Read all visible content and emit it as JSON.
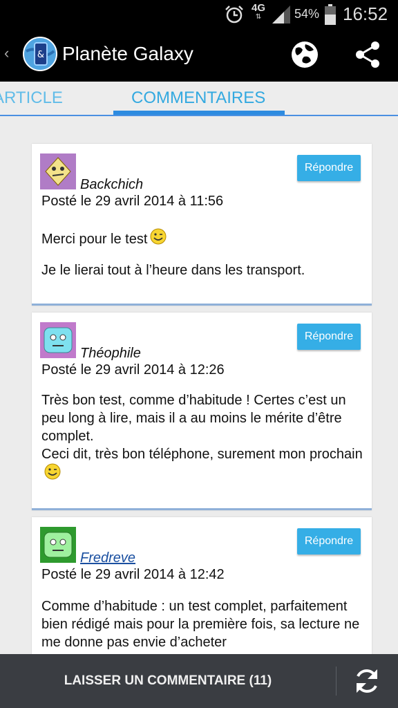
{
  "status_bar": {
    "network": "4G",
    "battery": "54%",
    "time": "16:52",
    "icons": [
      "alarm-icon",
      "signal-icon",
      "battery-icon"
    ]
  },
  "action_bar": {
    "title": "Planète Galaxy",
    "icons": [
      "back-chevron-icon",
      "app-logo",
      "globe-icon",
      "share-icon"
    ]
  },
  "tabs": [
    {
      "label": "ARTICLE",
      "selected": false
    },
    {
      "label": "COMMENTAIRES",
      "selected": true
    }
  ],
  "comments": [
    {
      "author": "Backchich",
      "date": "Posté le 29 avril 2014 à 11:56",
      "reply_label": "Répondre",
      "paragraphs": [
        "Merci pour le test",
        "Je le lierai tout à l’heure dans les transport."
      ]
    },
    {
      "author": "Théophile",
      "date": "Posté le 29 avril 2014 à 12:26",
      "reply_label": "Répondre",
      "paragraphs": [
        "Très bon test, comme d’habitude ! Certes c’est un peu long à lire, mais il a au moins le mérite d’être complet.",
        "Ceci dit, très bon téléphone, surement mon prochain"
      ]
    },
    {
      "author": "Fredreve",
      "date": "Posté le 29 avril 2014 à 12:42",
      "reply_label": "Répondre",
      "paragraphs": [
        "Comme d’habitude : un test complet, parfaitement bien rédigé mais pour la première fois, sa lecture ne me donne pas envie d’acheter"
      ]
    }
  ],
  "bottom_bar": {
    "leave_comment_label": "LAISSER UN COMMENTAIRE (11)",
    "refresh_icon": "refresh-icon"
  },
  "colors": {
    "accent": "#33a9e0",
    "reply_button": "#35aee6",
    "bottom_bar": "#3a3d42"
  }
}
